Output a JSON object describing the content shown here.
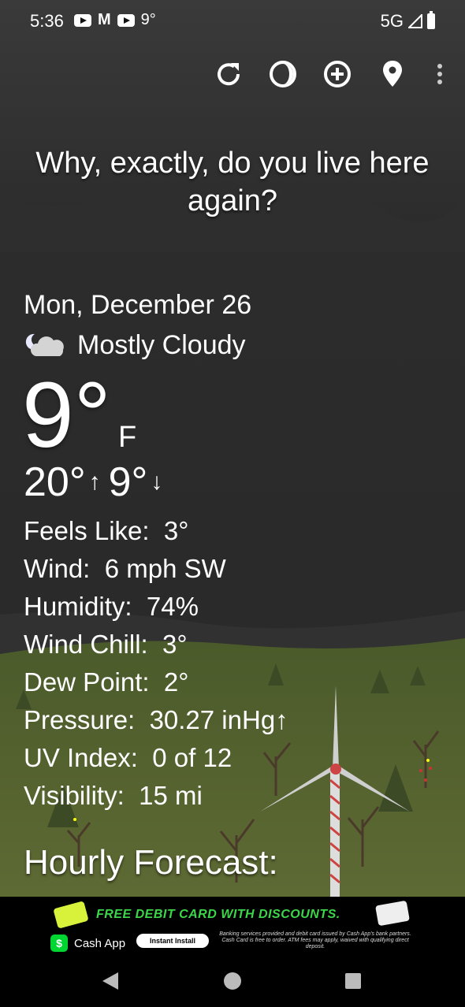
{
  "status_bar": {
    "time": "5:36",
    "notif_mail": "M",
    "notif_temp": "9°",
    "network": "5G"
  },
  "toolbar": {
    "icons": [
      "refresh-icon",
      "theme-icon",
      "add-location-icon",
      "location-pin-icon",
      "more-vert-icon"
    ]
  },
  "weather": {
    "tagline": "Why, exactly, do you live here again?",
    "date": "Mon, December 26",
    "condition": "Mostly Cloudy",
    "temp": "9°",
    "unit": "F",
    "high": "20°",
    "low": "9°",
    "details": [
      {
        "label": "Feels Like:",
        "value": "3°"
      },
      {
        "label": "Wind:",
        "value": "6 mph SW"
      },
      {
        "label": "Humidity:",
        "value": "74%"
      },
      {
        "label": "Wind Chill:",
        "value": "3°"
      },
      {
        "label": "Dew Point:",
        "value": "2°"
      },
      {
        "label": "Pressure:",
        "value": "30.27 inHg↑"
      },
      {
        "label": "UV Index:",
        "value": "0 of 12"
      },
      {
        "label": "Visibility:",
        "value": "15 mi"
      }
    ],
    "hourly_title": "Hourly Forecast:"
  },
  "ad": {
    "headline": "FREE DEBIT CARD WITH DISCOUNTS.",
    "brand": "Cash App",
    "install": "Instant Install",
    "fine_print": "Banking services provided and debit card issued by Cash App's bank partners. Cash Card is free to order. ATM fees may apply, waived with qualifying direct deposit."
  },
  "colors": {
    "ad_green": "#3cd64a",
    "cash_app": "#00d632"
  }
}
